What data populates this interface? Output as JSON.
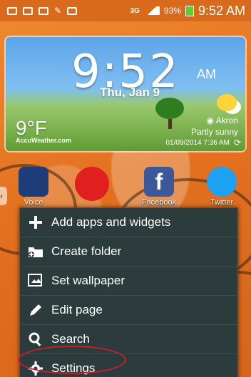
{
  "status_bar": {
    "network": "3G",
    "battery": "93%",
    "time": "9:52 AM"
  },
  "widget": {
    "time": "9:52",
    "ampm": "AM",
    "date": "Thu, Jan 9",
    "temperature": "9°F",
    "brand": "AccuWeather.com",
    "city": "Akron",
    "condition": "Partly sunny",
    "updated": "01/09/2014 7:36 AM"
  },
  "apps": [
    {
      "label": "Voice",
      "color": "#1e3c78"
    },
    {
      "label": "",
      "color": "#e02020"
    },
    {
      "label": "Facebook",
      "color": "#3b5998"
    },
    {
      "label": "Twitter",
      "color": "#1da1f2"
    }
  ],
  "menu": {
    "items": [
      {
        "label": "Add apps and widgets",
        "icon": "plus-icon"
      },
      {
        "label": "Create folder",
        "icon": "folder-icon"
      },
      {
        "label": "Set wallpaper",
        "icon": "wallpaper-icon"
      },
      {
        "label": "Edit page",
        "icon": "pencil-icon"
      },
      {
        "label": "Search",
        "icon": "search-icon"
      },
      {
        "label": "Settings",
        "icon": "gear-icon"
      }
    ]
  },
  "colors": {
    "menu_bg": "#2c3c3c",
    "highlight_ring": "#c8202a",
    "wallpaper": "#e8782a"
  }
}
